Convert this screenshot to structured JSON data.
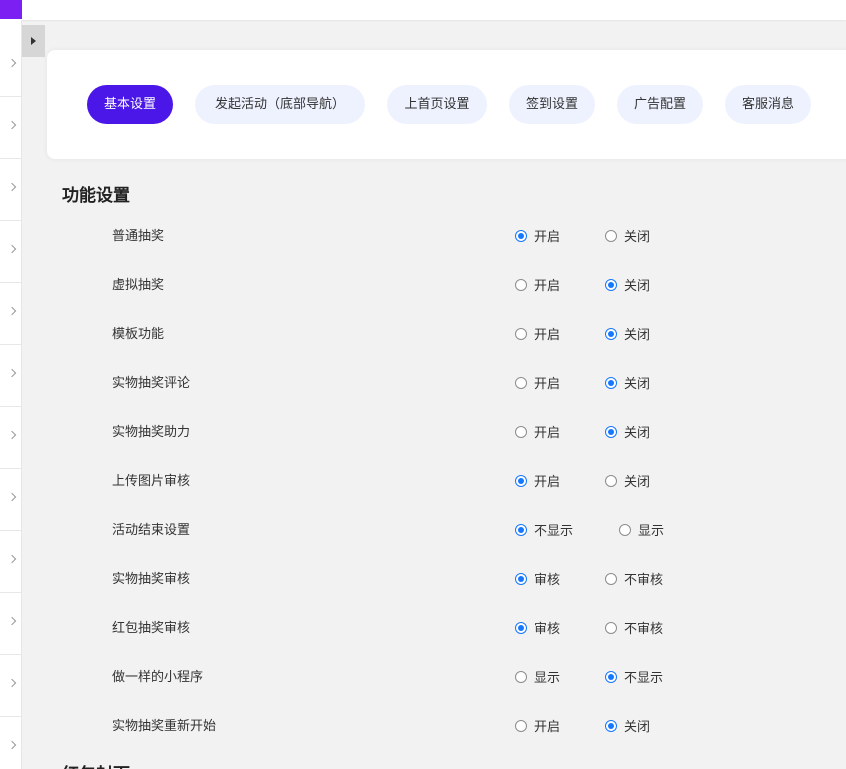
{
  "tabs": [
    {
      "label": "基本设置",
      "active": true
    },
    {
      "label": "发起活动（底部导航）",
      "active": false
    },
    {
      "label": "上首页设置",
      "active": false
    },
    {
      "label": "签到设置",
      "active": false
    },
    {
      "label": "广告配置",
      "active": false
    },
    {
      "label": "客服消息",
      "active": false
    }
  ],
  "section_title": "功能设置",
  "next_section_title": "红包封面",
  "settings": [
    {
      "label": "普通抽奖",
      "options": [
        "开启",
        "关闭"
      ],
      "selected": 0
    },
    {
      "label": "虚拟抽奖",
      "options": [
        "开启",
        "关闭"
      ],
      "selected": 1
    },
    {
      "label": "模板功能",
      "options": [
        "开启",
        "关闭"
      ],
      "selected": 1
    },
    {
      "label": "实物抽奖评论",
      "options": [
        "开启",
        "关闭"
      ],
      "selected": 1
    },
    {
      "label": "实物抽奖助力",
      "options": [
        "开启",
        "关闭"
      ],
      "selected": 1
    },
    {
      "label": "上传图片审核",
      "options": [
        "开启",
        "关闭"
      ],
      "selected": 0
    },
    {
      "label": "活动结束设置",
      "options": [
        "不显示",
        "显示"
      ],
      "selected": 0
    },
    {
      "label": "实物抽奖审核",
      "options": [
        "审核",
        "不审核"
      ],
      "selected": 0
    },
    {
      "label": "红包抽奖审核",
      "options": [
        "审核",
        "不审核"
      ],
      "selected": 0
    },
    {
      "label": "做一样的小程序",
      "options": [
        "显示",
        "不显示"
      ],
      "selected": 1
    },
    {
      "label": "实物抽奖重新开始",
      "options": [
        "开启",
        "关闭"
      ],
      "selected": 1
    }
  ],
  "colors": {
    "accent": "#4a17e8",
    "radio": "#1677ff",
    "brand": "#7b1ff2"
  },
  "icons": {
    "sidebar_toggle": "caret-right-icon",
    "sidebar_row": "chevron-right-icon"
  }
}
